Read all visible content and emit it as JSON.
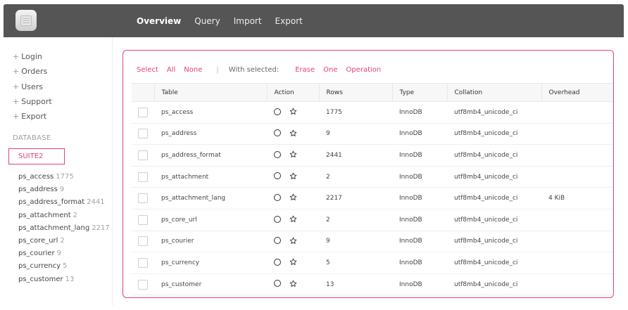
{
  "header": {
    "logo_icon": "database-app-icon",
    "nav": [
      {
        "label": "Overview",
        "active": true
      },
      {
        "label": "Query",
        "active": false
      },
      {
        "label": "Import",
        "active": false
      },
      {
        "label": "Export",
        "active": false
      }
    ]
  },
  "sidebar": {
    "links": [
      {
        "label": "Login"
      },
      {
        "label": "Orders"
      },
      {
        "label": "Users"
      },
      {
        "label": "Support"
      },
      {
        "label": "Export"
      }
    ],
    "plus_glyph": "+",
    "database_heading": "DATABASE",
    "database_selected": "SUITE2",
    "tables": [
      {
        "name": "ps_access",
        "count": "1775"
      },
      {
        "name": "ps_address",
        "count": "9"
      },
      {
        "name": "ps_address_format",
        "count": "2441"
      },
      {
        "name": "ps_attachment",
        "count": "2"
      },
      {
        "name": "ps_attachment_lang",
        "count": "2217"
      },
      {
        "name": "ps_core_url",
        "count": "2"
      },
      {
        "name": "ps_courier",
        "count": "9"
      },
      {
        "name": "ps_currency",
        "count": "5"
      },
      {
        "name": "ps_customer",
        "count": "13"
      }
    ]
  },
  "toolbar": {
    "select_label": "Select",
    "all_label": "All",
    "none_label": "None",
    "separator": "|",
    "with_selected_label": "With selected:",
    "erase_label": "Erase",
    "one_label": "One",
    "operation_label": "Operation"
  },
  "table": {
    "columns": [
      "",
      "Table",
      "Action",
      "Rows",
      "Type",
      "Collation",
      "Overhead"
    ],
    "rows": [
      {
        "table": "ps_access",
        "rows": "1775",
        "type": "InnoDB",
        "collation": "utf8mb4_unicode_ci",
        "overhead": ""
      },
      {
        "table": "ps_address",
        "rows": "9",
        "type": "InnoDB",
        "collation": "utf8mb4_unicode_ci",
        "overhead": ""
      },
      {
        "table": "ps_address_format",
        "rows": "2441",
        "type": "InnoDB",
        "collation": "utf8mb4_unicode_ci",
        "overhead": ""
      },
      {
        "table": "ps_attachment",
        "rows": "2",
        "type": "InnoDB",
        "collation": "utf8mb4_unicode_ci",
        "overhead": ""
      },
      {
        "table": "ps_attachment_lang",
        "rows": "2217",
        "type": "InnoDB",
        "collation": "utf8mb4_unicode_ci",
        "overhead": "4 KiB"
      },
      {
        "table": "ps_core_url",
        "rows": "2",
        "type": "InnoDB",
        "collation": "utf8mb4_unicode_ci",
        "overhead": ""
      },
      {
        "table": "ps_courier",
        "rows": "9",
        "type": "InnoDB",
        "collation": "utf8mb4_unicode_ci",
        "overhead": ""
      },
      {
        "table": "ps_currency",
        "rows": "5",
        "type": "InnoDB",
        "collation": "utf8mb4_unicode_ci",
        "overhead": ""
      },
      {
        "table": "ps_customer",
        "rows": "13",
        "type": "InnoDB",
        "collation": "utf8mb4_unicode_ci",
        "overhead": ""
      }
    ],
    "action_icons": [
      "circle-icon",
      "star-icon"
    ]
  },
  "colors": {
    "accent": "#e3427a",
    "header_bg": "#555555",
    "header_text": "#ffffff"
  }
}
